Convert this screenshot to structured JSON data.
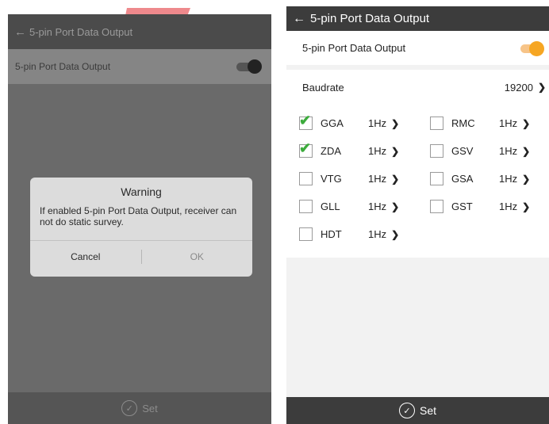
{
  "left": {
    "title": "5-pin Port Data Output",
    "toggle_label": "5-pin Port Data Output",
    "dialog": {
      "title": "Warning",
      "message": "If enabled 5-pin Port Data Output, receiver can not do static survey.",
      "cancel": "Cancel",
      "ok": "OK"
    },
    "set_label": "Set"
  },
  "right": {
    "title": "5-pin Port Data Output",
    "toggle_label": "5-pin Port Data Output",
    "toggle_on": true,
    "baudrate_label": "Baudrate",
    "baudrate_value": "19200",
    "messages": [
      {
        "name": "GGA",
        "freq": "1Hz",
        "checked": true
      },
      {
        "name": "RMC",
        "freq": "1Hz",
        "checked": false
      },
      {
        "name": "ZDA",
        "freq": "1Hz",
        "checked": true
      },
      {
        "name": "GSV",
        "freq": "1Hz",
        "checked": false
      },
      {
        "name": "VTG",
        "freq": "1Hz",
        "checked": false
      },
      {
        "name": "GSA",
        "freq": "1Hz",
        "checked": false
      },
      {
        "name": "GLL",
        "freq": "1Hz",
        "checked": false
      },
      {
        "name": "GST",
        "freq": "1Hz",
        "checked": false
      },
      {
        "name": "HDT",
        "freq": "1Hz",
        "checked": false
      }
    ],
    "set_label": "Set"
  },
  "colors": {
    "accent": "#f6a623",
    "check": "#3cab3c",
    "appbar": "#3c3c3c",
    "watermark": "#e0282d"
  },
  "icons": {
    "back": "back-arrow-icon",
    "chevron": "chevron-right-icon",
    "set": "check-circle-icon",
    "checkbox": "checkmark-icon"
  }
}
